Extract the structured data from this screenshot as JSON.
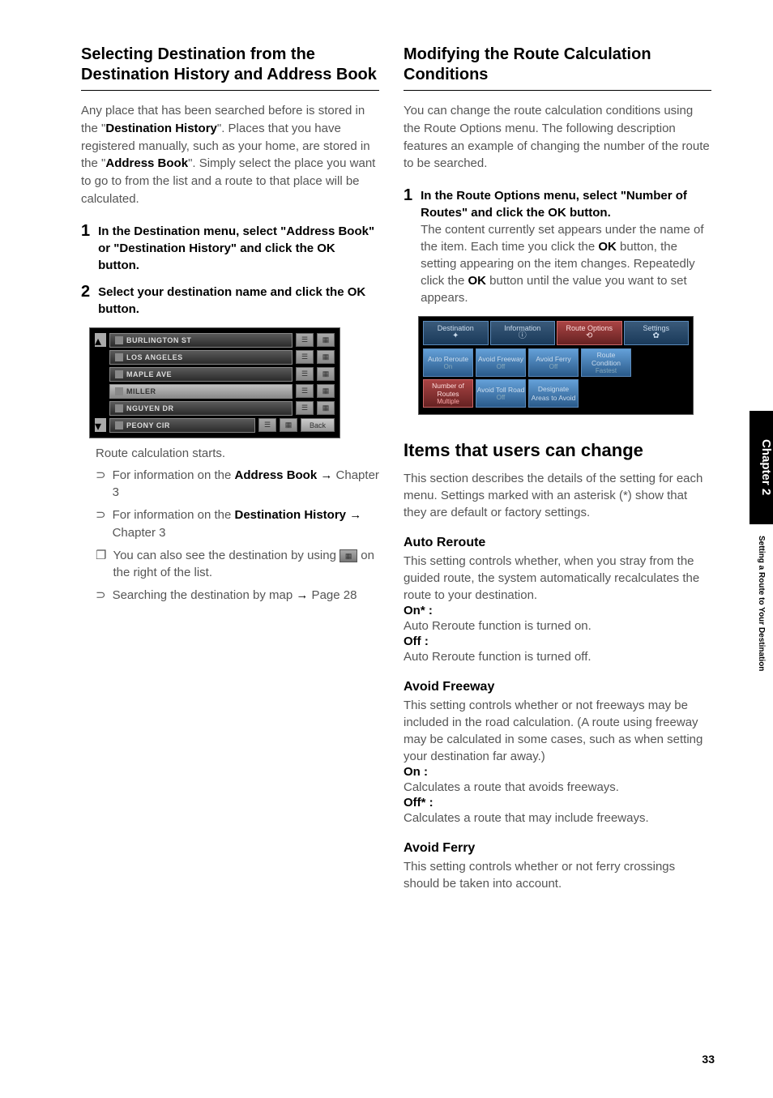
{
  "left": {
    "h2": "Selecting Destination from the Destination History and Address Book",
    "intro_parts": {
      "p1": "Any place that has been searched before is stored in the \"",
      "b1": "Destination History",
      "p2": "\". Places that you have registered manually, such as your home, are stored in the \"",
      "b2": "Address Book",
      "p3": "\". Simply select the place you want to go to from the list and a route to that place will be calculated."
    },
    "step1_num": "1",
    "step1": "In the Destination menu, select \"Address Book\" or \"Destination History\" and click the OK button.",
    "step2_num": "2",
    "step2": "Select your destination name and click the OK button.",
    "list_items": [
      "BURLINGTON ST",
      "LOS ANGELES",
      "MAPLE AVE",
      "MILLER",
      "NGUYEN DR",
      "PEONY CIR"
    ],
    "back_label": "Back",
    "caption": "Route calculation starts.",
    "note1_a": "For information on the ",
    "note1_b": "Address Book",
    "note1_c": " Chapter 3",
    "note2_a": "For information on the ",
    "note2_b": "Destination History",
    "note2_c": " Chapter 3",
    "note3_a": "You can also see the destination by using ",
    "note3_b": " on the right of the list.",
    "note4_a": "Searching the destination by map ",
    "note4_b": " Page 28"
  },
  "right": {
    "h2": "Modifying the Route Calculation Conditions",
    "intro": "You can change the route calculation conditions using the Route Options menu. The following description features an example of changing the number of the route to be searched.",
    "step1_num": "1",
    "step1_bold": "In the Route Options menu, select \"Number of Routes\" and click the OK button.",
    "step1_plain_a": "The content currently set appears under the name of the item. Each time you click the ",
    "step1_ok1": "OK",
    "step1_plain_b": " button, the setting appearing on the item changes. Repeatedly click the ",
    "step1_ok2": "OK",
    "step1_plain_c": " button until the value you want to set appears.",
    "tabs": [
      "Destination",
      "Information",
      "Route Options",
      "Settings"
    ],
    "row1": [
      {
        "t": "Auto Reroute",
        "s": "On"
      },
      {
        "t": "Avoid Freeway",
        "s": "Off"
      },
      {
        "t": "Avoid Ferry",
        "s": "Off"
      },
      {
        "t": "Route Condition",
        "s": "Fastest"
      }
    ],
    "row2": [
      {
        "t": "Number of Routes",
        "s": "Multiple"
      },
      {
        "t": "Avoid Toll Road",
        "s": "Off"
      },
      {
        "t": "Designate Areas to Avoid",
        "s": ""
      }
    ],
    "h2_items": "Items that users can change",
    "items_intro": "This section describes the details of the setting for each menu. Settings marked with an asterisk (*) show that they are default or factory settings.",
    "auto_reroute_h": "Auto Reroute",
    "auto_reroute_body": "This setting controls whether, when you stray from the guided route, the system automatically recalculates the route to your destination.",
    "on_star": "On* :",
    "ar_on": "Auto Reroute function is turned on.",
    "off_label": "Off :",
    "ar_off": "Auto Reroute function is turned off.",
    "avoid_fwy_h": "Avoid Freeway",
    "avoid_fwy_body": "This setting controls whether or not freeways may be included in the road calculation. (A route using freeway may be calculated in some cases, such as when setting your destination far away.)",
    "on_label": "On :",
    "af_on": "Calculates a route that avoids freeways.",
    "off_star": "Off* :",
    "af_off": "Calculates a route that may include freeways.",
    "avoid_ferry_h": "Avoid Ferry",
    "avoid_ferry_body": "This setting controls whether or not ferry crossings should be taken into account."
  },
  "side": {
    "chapter": "Chapter 2",
    "title": "Setting a Route to Your Destination"
  },
  "page_num": "33"
}
